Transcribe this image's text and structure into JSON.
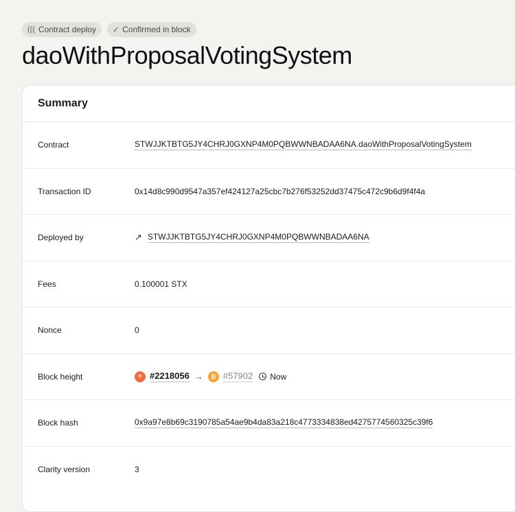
{
  "tags": [
    {
      "icon": "contract-icon",
      "label": "Contract deploy"
    },
    {
      "icon": "check-icon",
      "label": "Confirmed in block"
    }
  ],
  "title": "daoWithProposalVotingSystem",
  "summary": {
    "heading": "Summary",
    "contract": {
      "label": "Contract",
      "value": "STWJJKTBTG5JY4CHRJ0GXNP4M0PQBWWNBADAA6NA.daoWithProposalVotingSystem"
    },
    "transaction_id": {
      "label": "Transaction ID",
      "value": "0x14d8c990d9547a357ef424127a25cbc7b276f53252dd37475c472c9b6d9f4f4a"
    },
    "deployed_by": {
      "label": "Deployed by",
      "icon": "arrow-up-right-icon",
      "value": "STWJJKTBTG5JY4CHRJ0GXNP4M0PQBWWNBADAA6NA"
    },
    "fees": {
      "label": "Fees",
      "value": "0.100001 STX"
    },
    "nonce": {
      "label": "Nonce",
      "value": "0"
    },
    "block_height": {
      "label": "Block height",
      "stacks_height": "#2218056",
      "arrow": "→",
      "btc_height": "#57902",
      "time": "Now",
      "stacks_color": "#f0693f",
      "btc_color": "#f7a32c"
    },
    "block_hash": {
      "label": "Block hash",
      "value": "0x9a97e8b69c3190785a54ae9b4da83a218c4773334838ed4275774560325c39f6"
    },
    "clarity_version": {
      "label": "Clarity version",
      "value": "3"
    }
  }
}
